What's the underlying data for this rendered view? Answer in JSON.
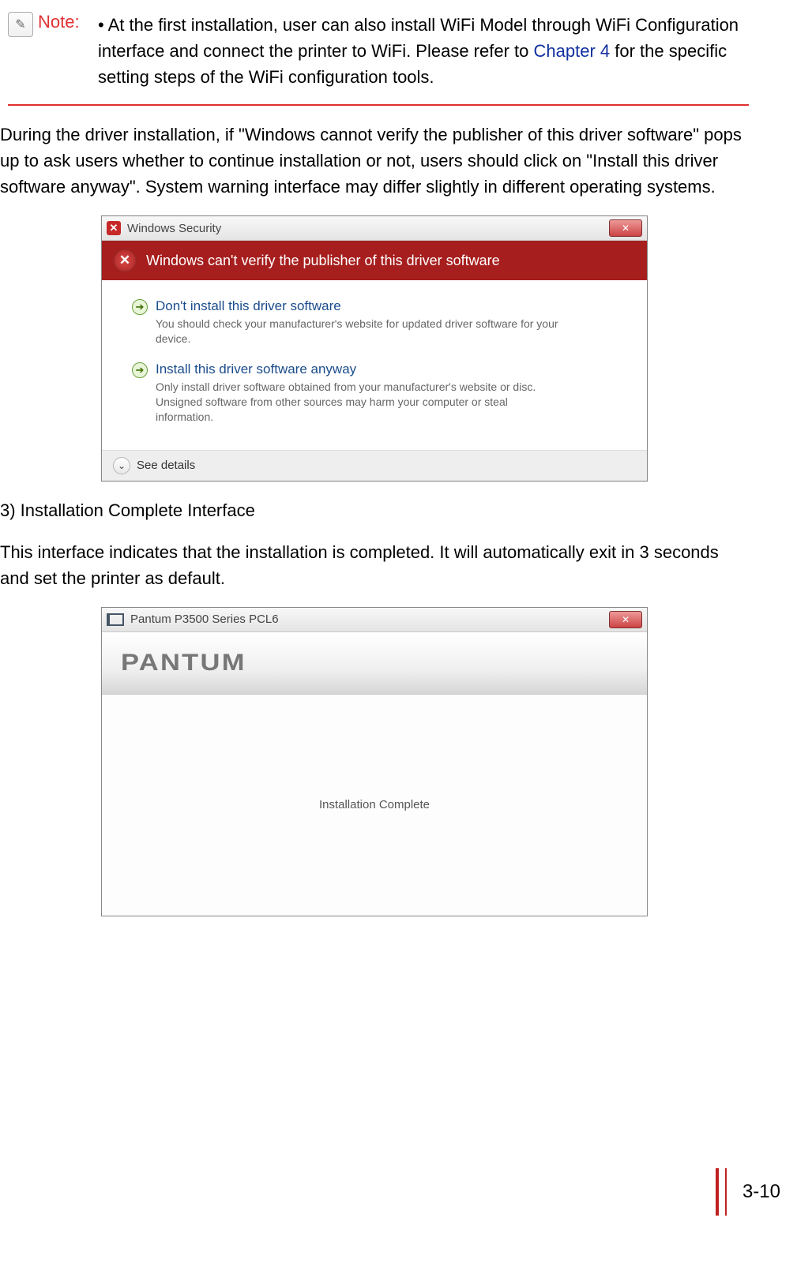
{
  "note": {
    "label": "Note:",
    "text_before_link": "• At the first installation, user can also install WiFi Model through WiFi Configuration interface and connect the printer to WiFi. Please refer to ",
    "link": "Chapter 4",
    "text_after_link": " for the specific setting steps of the WiFi configuration tools."
  },
  "para1": "During the driver installation, if \"Windows cannot verify the publisher of this driver software\" pops up to ask users whether to continue installation or not, users should click on \"Install this driver software anyway\". System warning interface may differ slightly in different operating systems.",
  "security_dialog": {
    "title": "Windows Security",
    "banner": "Windows can't verify the publisher of this driver software",
    "option1": {
      "title": "Don't install this driver software",
      "desc": "You should check your manufacturer's website for updated driver software for your device."
    },
    "option2": {
      "title": "Install this driver software anyway",
      "desc": "Only install driver software obtained from your manufacturer's website or disc. Unsigned software from other sources may harm your computer or steal information."
    },
    "see_details": "See details"
  },
  "step3_heading": "3) Installation Complete Interface",
  "para2": "This interface indicates that the installation is completed. It will automatically exit in 3 seconds and set the printer as default.",
  "pantum_dialog": {
    "title": "Pantum P3500 Series PCL6",
    "logo": "PANTUM",
    "body": "Installation Complete"
  },
  "page_number": "3-10"
}
